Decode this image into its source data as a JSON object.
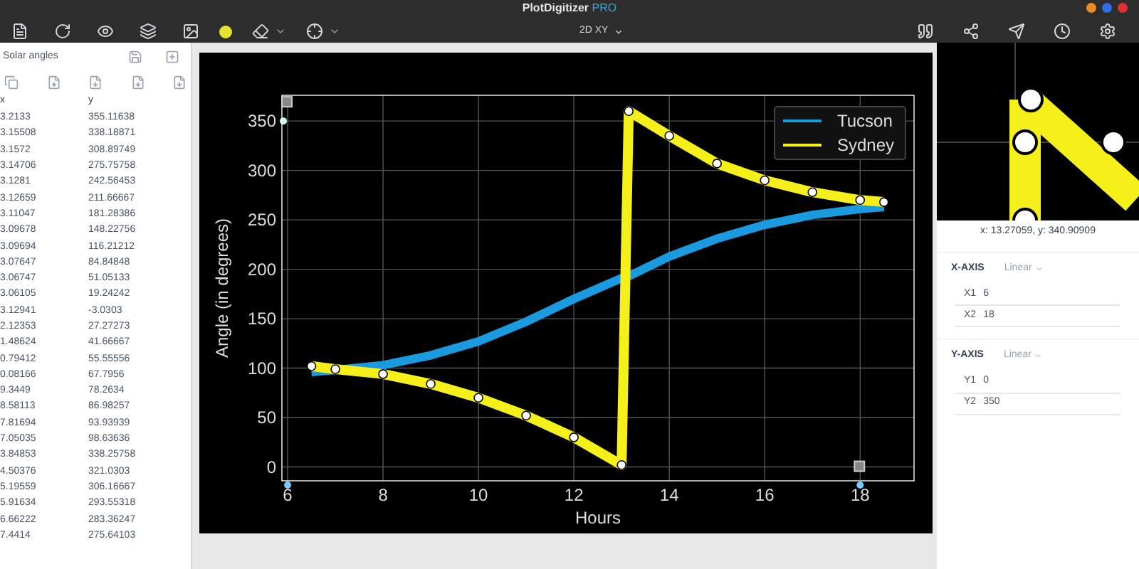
{
  "app": {
    "title": "PlotDigitizer",
    "badge": "PRO",
    "mode": "2D XY"
  },
  "dataset": {
    "name": "Solar angles"
  },
  "table": {
    "columns": [
      "x",
      "y"
    ],
    "rows": [
      [
        "3.2133",
        "355.11638"
      ],
      [
        "3.15508",
        "338.18871"
      ],
      [
        "3.1572",
        "308.89749"
      ],
      [
        "3.14706",
        "275.75758"
      ],
      [
        "3.1281",
        "242.56453"
      ],
      [
        "3.12659",
        "211.66667"
      ],
      [
        "3.11047",
        "181.28386"
      ],
      [
        "3.09678",
        "148.22756"
      ],
      [
        "3.09694",
        "116.21212"
      ],
      [
        "3.07647",
        "84.84848"
      ],
      [
        "3.06747",
        "51.05133"
      ],
      [
        "3.06105",
        "19.24242"
      ],
      [
        "3.12941",
        "-3.0303"
      ],
      [
        "2.12353",
        "27.27273"
      ],
      [
        "1.48624",
        "41.66667"
      ],
      [
        "0.79412",
        "55.55556"
      ],
      [
        "0.08166",
        "67.7956"
      ],
      [
        "9.3449",
        "78.2634"
      ],
      [
        "8.58113",
        "86.98257"
      ],
      [
        "7.81694",
        "93.93939"
      ],
      [
        "7.05035",
        "98.63636"
      ],
      [
        "3.84853",
        "338.25758"
      ],
      [
        "4.50376",
        "321.0303"
      ],
      [
        "5.19559",
        "306.16667"
      ],
      [
        "5.91634",
        "293.55318"
      ],
      [
        "6.66222",
        "283.36247"
      ],
      [
        "7.4414",
        "275.64103"
      ]
    ]
  },
  "canvas": {
    "chart_data": {
      "type": "line",
      "grid": true,
      "legend": true,
      "xlabel": "Hours",
      "ylabel": "Angle (in degrees)",
      "x": [
        6.5,
        7,
        8,
        9,
        10,
        11,
        12,
        13,
        13.15,
        14,
        15,
        16,
        17,
        18,
        18.5
      ],
      "series": [
        {
          "name": "Tucson",
          "color": "#1a9be0",
          "values": [
            96,
            98,
            103,
            113,
            127,
            147,
            170,
            191,
            193,
            213,
            231,
            245,
            255,
            261,
            263
          ]
        },
        {
          "name": "Sydney",
          "color": "#f5f01a",
          "marker": "o",
          "values": [
            102,
            99,
            94,
            84,
            70,
            52,
            30,
            2,
            360,
            335,
            307,
            290,
            278,
            270,
            268
          ]
        }
      ],
      "xlim": [
        5.88,
        19.13
      ],
      "ylim": [
        -14,
        376
      ],
      "xticks": [
        6,
        8,
        10,
        12,
        14,
        16,
        18
      ],
      "yticks": [
        0,
        50,
        100,
        150,
        200,
        250,
        300,
        350
      ]
    }
  },
  "cursor": "x: 13.27059, y: 340.90909",
  "axes": [
    {
      "label": "X-AXIS",
      "scale": "Linear",
      "fields": [
        {
          "label": "X1",
          "value": "6"
        },
        {
          "label": "X2",
          "value": "18"
        }
      ]
    },
    {
      "label": "Y-AXIS",
      "scale": "Linear",
      "fields": [
        {
          "label": "Y1",
          "value": "0"
        },
        {
          "label": "Y2",
          "value": "350"
        }
      ]
    }
  ]
}
